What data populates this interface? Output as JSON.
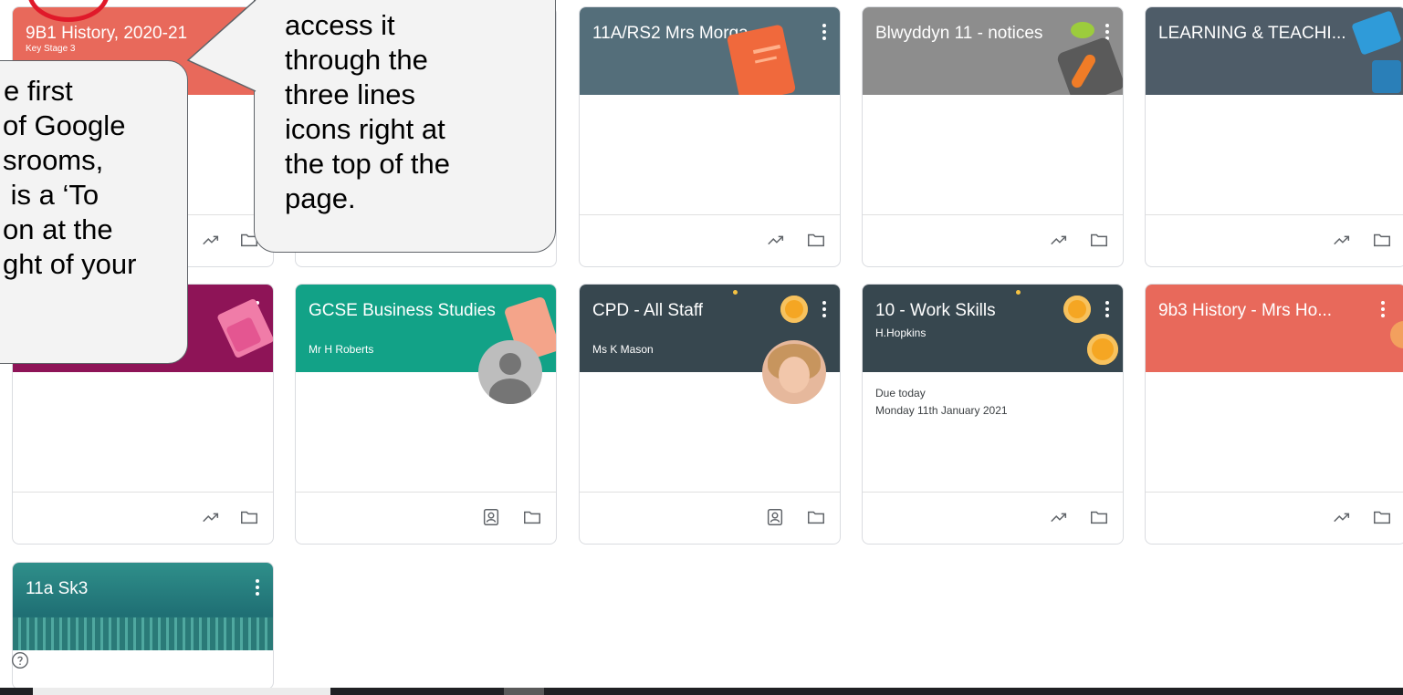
{
  "cards": [
    {
      "id": "9b1",
      "title": "9B1 History, 2020-21",
      "subtitle": "Key Stage 3",
      "color": "#e8695b"
    },
    {
      "id": "11a-rs2",
      "title": "11A/RS2 Mrs Morgan (...",
      "subtitle": "",
      "color": "#546e7a"
    },
    {
      "id": "blwyddyn",
      "title": "Blwyddyn 11 - notices",
      "subtitle": "",
      "color": "#8d8d8d"
    },
    {
      "id": "learning",
      "title": "LEARNING & TEACHI...",
      "subtitle": "",
      "color": "#4e5c68"
    },
    {
      "id": "purple",
      "title": "",
      "subtitle": "",
      "color": "#8e1457"
    },
    {
      "id": "gcse",
      "title": "GCSE Business Studies",
      "subtitle": "Mr H Roberts",
      "color": "#12a287"
    },
    {
      "id": "cpd",
      "title": "CPD - All Staff",
      "subtitle": "Ms K Mason",
      "color": "#37474f"
    },
    {
      "id": "work-skills",
      "title": "10 - Work Skills",
      "subtitle": "H.Hopkins",
      "color": "#37474f",
      "due_label": "Due today",
      "due_item": "Monday 11th January 2021"
    },
    {
      "id": "9b3",
      "title": "9b3 History - Mrs Ho...",
      "subtitle": "",
      "color": "#e8695b"
    },
    {
      "id": "11a-sk3",
      "title": "11a Sk3",
      "subtitle": "",
      "color": "#2e8b87"
    }
  ],
  "callouts": {
    "left_lines": [
      "e first",
      "of Google",
      "srooms,",
      " is a ‘To",
      "on at the",
      "ght of your"
    ],
    "center_lines": [
      "access it",
      "through the",
      "three lines",
      "icons right at",
      "the top of the",
      "page."
    ]
  },
  "help_icon": "help-circle-icon",
  "icons": {
    "trending": "trending-up-icon",
    "folder": "folder-icon",
    "portrait": "portrait-icon"
  }
}
